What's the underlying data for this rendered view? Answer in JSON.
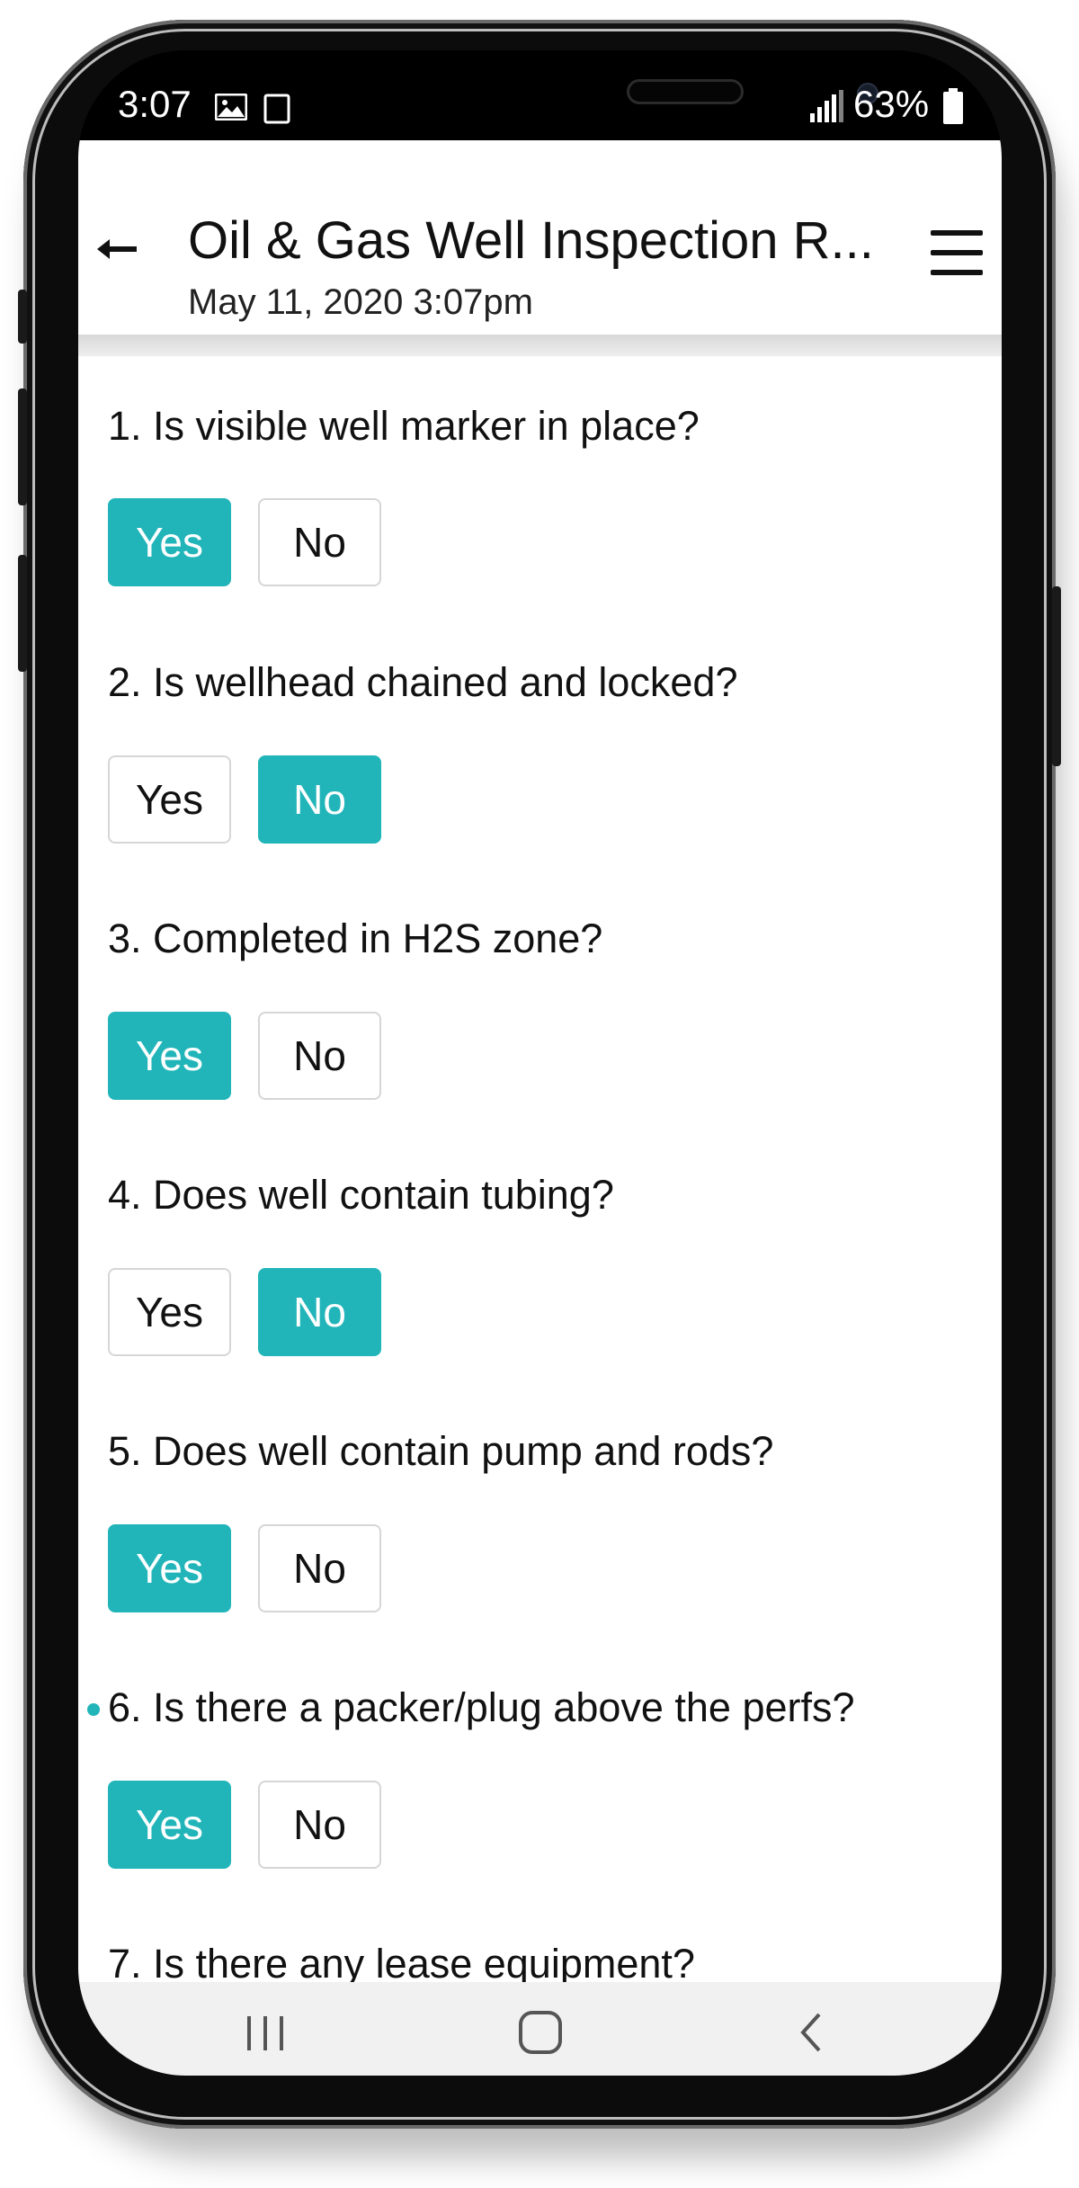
{
  "status_bar": {
    "time": "3:07",
    "battery": "63%",
    "icons": [
      "image-icon",
      "partial-notification-icon",
      "signal-icon",
      "battery-icon"
    ]
  },
  "header": {
    "title": "Oil & Gas Well Inspection R...",
    "subtitle": "May 11, 2020 3:07pm",
    "back_icon": "back-arrow-icon",
    "menu_icon": "hamburger-menu-icon"
  },
  "accent_color": "#21b5b9",
  "questions": [
    {
      "text": "1. Is visible well marker in place?",
      "yes": "Yes",
      "no": "No",
      "selected": "Yes"
    },
    {
      "text": "2. Is wellhead chained and locked?",
      "yes": "Yes",
      "no": "No",
      "selected": "No"
    },
    {
      "text": "3. Completed in H2S zone?",
      "yes": "Yes",
      "no": "No",
      "selected": "Yes"
    },
    {
      "text": "4. Does well contain tubing?",
      "yes": "Yes",
      "no": "No",
      "selected": "No"
    },
    {
      "text": "5. Does well contain pump and rods?",
      "yes": "Yes",
      "no": "No",
      "selected": "Yes"
    },
    {
      "text": "6. Is there a packer/plug above the perfs?",
      "yes": "Yes",
      "no": "No",
      "selected": "Yes"
    },
    {
      "text": "7. Is there any lease equipment?"
    }
  ],
  "nav_bar": {
    "icons": [
      "recent-apps-icon",
      "home-icon",
      "back-nav-icon"
    ]
  }
}
